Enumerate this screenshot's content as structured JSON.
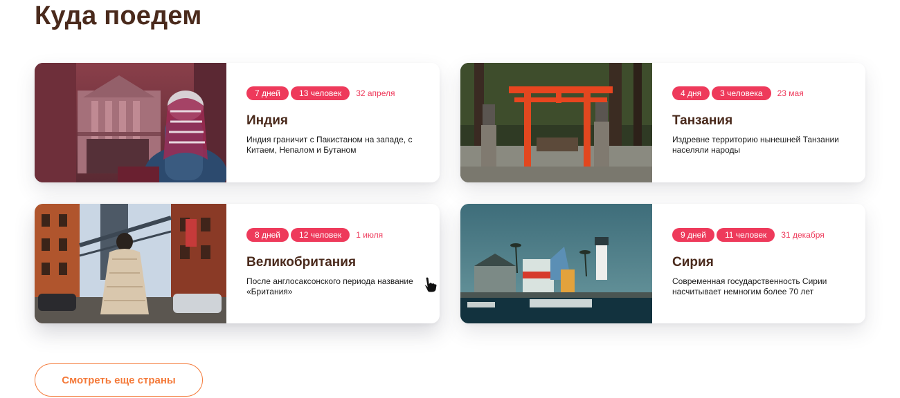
{
  "section": {
    "title": "Куда поедем",
    "more_button": "Смотреть еще страны"
  },
  "colors": {
    "heading": "#4a2a1c",
    "tag_bg": "#ee3a5b",
    "accent": "#f47a3a"
  },
  "cards": [
    {
      "days": "7 дней",
      "people": "13 человек",
      "date": "32 апреля",
      "country": "Индия",
      "description": "Индия граничит с Пакистаном на западе, с Китаем, Непалом и Бутаном"
    },
    {
      "days": "4 дня",
      "people": "3 человека",
      "date": "23 мая",
      "country": "Танзания",
      "description": "Издревне территорию нынешней Танзании населяли народы"
    },
    {
      "days": "8 дней",
      "people": "12 человек",
      "date": "1 июля",
      "country": "Великобритания",
      "description": "После англосаксонского периода название «Британия»"
    },
    {
      "days": "9 дней",
      "people": "11 человек",
      "date": "31 декабря",
      "country": "Сирия",
      "description": "Современная государственность Сирии насчитывает немногим более 70 лет"
    }
  ]
}
